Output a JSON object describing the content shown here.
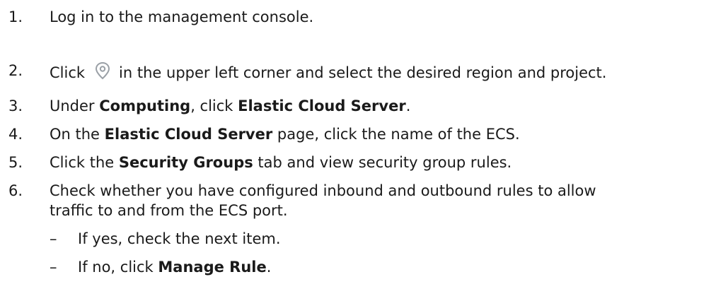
{
  "steps": [
    {
      "num": "1.",
      "text": "Log in to the management console."
    },
    {
      "num": "2.",
      "before": "Click",
      "icon": "region-pin-icon",
      "after": "in the upper left corner and select the desired region and project."
    },
    {
      "num": "3.",
      "pre": "Under ",
      "bold1": "Computing",
      "mid": ", click ",
      "bold2": "Elastic Cloud Server",
      "post": "."
    },
    {
      "num": "4.",
      "pre": "On the ",
      "bold1": "Elastic Cloud Server",
      "post": " page, click the name of the ECS."
    },
    {
      "num": "5.",
      "pre": "Click the ",
      "bold1": "Security Groups",
      "post": " tab and view security group rules."
    },
    {
      "num": "6.",
      "line1": "Check whether you have configured inbound and outbound rules to allow",
      "line2": "traffic to and from the ECS port."
    }
  ],
  "substeps": [
    {
      "dash": "–",
      "text": "If yes, check the next item."
    },
    {
      "dash": "–",
      "pre": "If no, click ",
      "bold1": "Manage Rule",
      "post": "."
    }
  ],
  "colors": {
    "text": "#1a1a1a",
    "icon": "#9aa0a6"
  }
}
